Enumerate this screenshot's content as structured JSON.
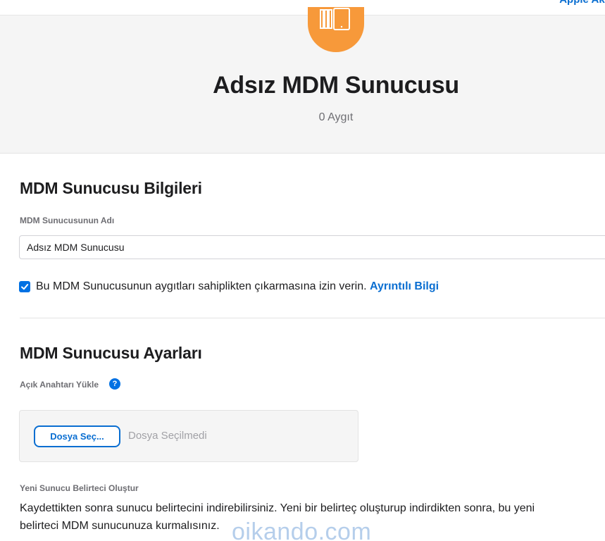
{
  "topbar": {
    "link": "Apple Aka"
  },
  "header": {
    "title": "Adsız MDM Sunucusu",
    "device_count": "0 Aygıt"
  },
  "info_section": {
    "title": "MDM Sunucusu Bilgileri",
    "name_label": "MDM Sunucusunun Adı",
    "name_value": "Adsız MDM Sunucusu",
    "checkbox_checked": true,
    "checkbox_text": "Bu MDM Sunucusunun aygıtları sahiplikten çıkarmasına izin verin.",
    "details_link": "Ayrıntılı Bilgi"
  },
  "settings_section": {
    "title": "MDM Sunucusu Ayarları",
    "public_key_label": "Açık Anahtarı Yükle",
    "help_symbol": "?",
    "choose_file_button": "Dosya Seç...",
    "file_status": "Dosya Seçilmedi",
    "token_label": "Yeni Sunucu Belirteci Oluştur",
    "token_description": "Kaydettikten sonra sunucu belirtecini indirebilirsiniz. Yeni bir belirteç oluşturup indirdikten sonra, bu yeni belirteci MDM sunucunuza kurmalısınız."
  },
  "watermark": "oikando.com",
  "colors": {
    "accent": "#0a6ed1",
    "icon_orange": "#f7993a",
    "header_bg": "#f5f5f5"
  },
  "icons": {
    "device": "devices-icon",
    "checkbox": "checkmark-icon",
    "help": "help-icon"
  }
}
